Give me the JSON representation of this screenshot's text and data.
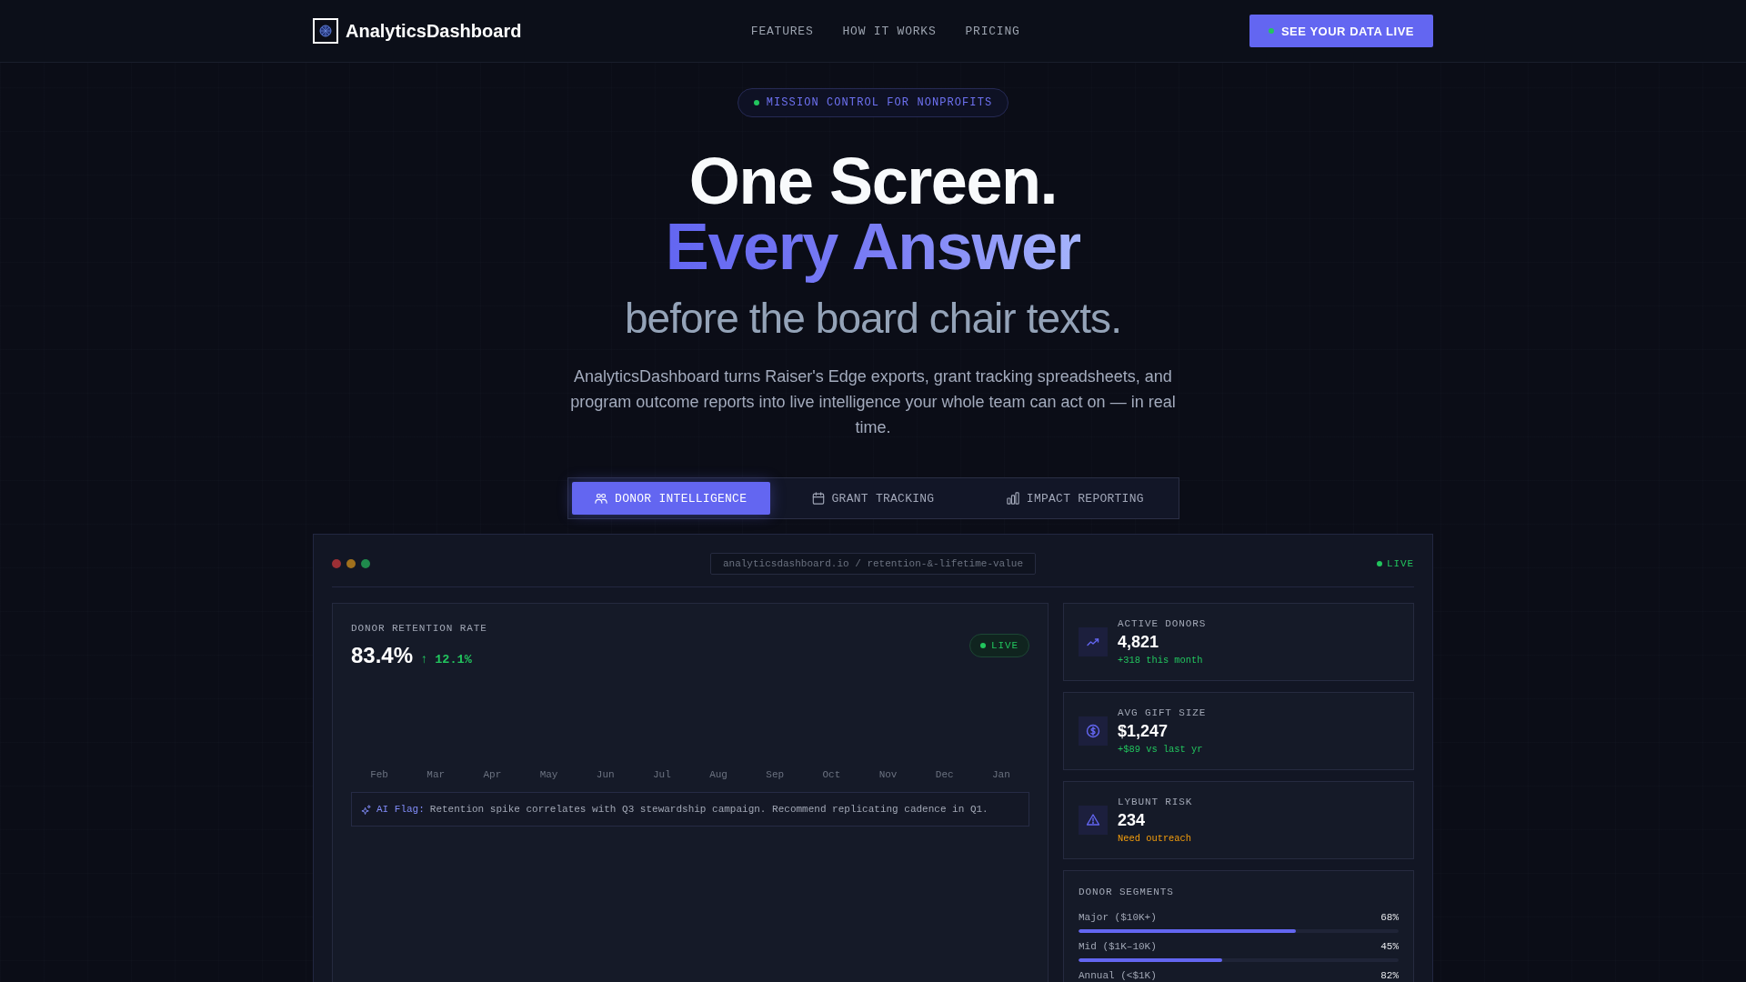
{
  "nav": {
    "logo": "AnalyticsDashboard",
    "links": [
      "FEATURES",
      "HOW IT WORKS",
      "PRICING"
    ],
    "cta": "SEE YOUR DATA LIVE"
  },
  "hero": {
    "badge": "MISSION CONTROL FOR NONPROFITS",
    "title": [
      "One Screen.",
      "Every Answer"
    ],
    "subtitle": "before the board chair texts.",
    "description": "AnalyticsDashboard turns Raiser's Edge exports, grant tracking spreadsheets, and program outcome reports into live intelligence your whole team can act on — in real time."
  },
  "tabs": [
    {
      "kind": "donors",
      "label": "DONOR INTELLIGENCE",
      "selected": true
    },
    {
      "kind": "grants",
      "label": "GRANT TRACKING",
      "selected": false
    },
    {
      "kind": "impact",
      "label": "IMPACT REPORTING",
      "selected": false
    }
  ],
  "dashboard": {
    "url": "analyticsdashboard.io / retention-&-lifetime-value",
    "status": "LIVE",
    "retention": {
      "title": "DONOR RETENTION RATE",
      "value": "83.4%",
      "change": "↑ 12.1%",
      "status": "LIVE",
      "months": [
        "Feb",
        "Mar",
        "Apr",
        "May",
        "Jun",
        "Jul",
        "Aug",
        "Sep",
        "Oct",
        "Nov",
        "Dec",
        "Jan"
      ],
      "ai_flag": {
        "label": "AI Flag:",
        "message": "Retention spike correlates with Q3 stewardship campaign. Recommend replicating cadence in Q1."
      }
    },
    "metrics": [
      {
        "kind": "trend",
        "label": "ACTIVE DONORS",
        "value": "4,821",
        "note": "+318 this month",
        "color": "#22c55e"
      },
      {
        "kind": "dollar",
        "label": "AVG GIFT SIZE",
        "value": "$1,247",
        "note": "+$89 vs last yr",
        "color": "#22c55e"
      },
      {
        "kind": "warning",
        "label": "LYBUNT RISK",
        "value": "234",
        "note": "Need outreach",
        "color": "#f59e0b"
      }
    ],
    "segments": {
      "title": "DONOR SEGMENTS",
      "items": [
        {
          "label": "Major ($10K+)",
          "value": "68%",
          "level": 0.68
        },
        {
          "label": "Mid ($1K–10K)",
          "value": "45%",
          "level": 0.45
        },
        {
          "label": "Annual (<$1K)",
          "value": "82%"
        }
      ]
    }
  }
}
